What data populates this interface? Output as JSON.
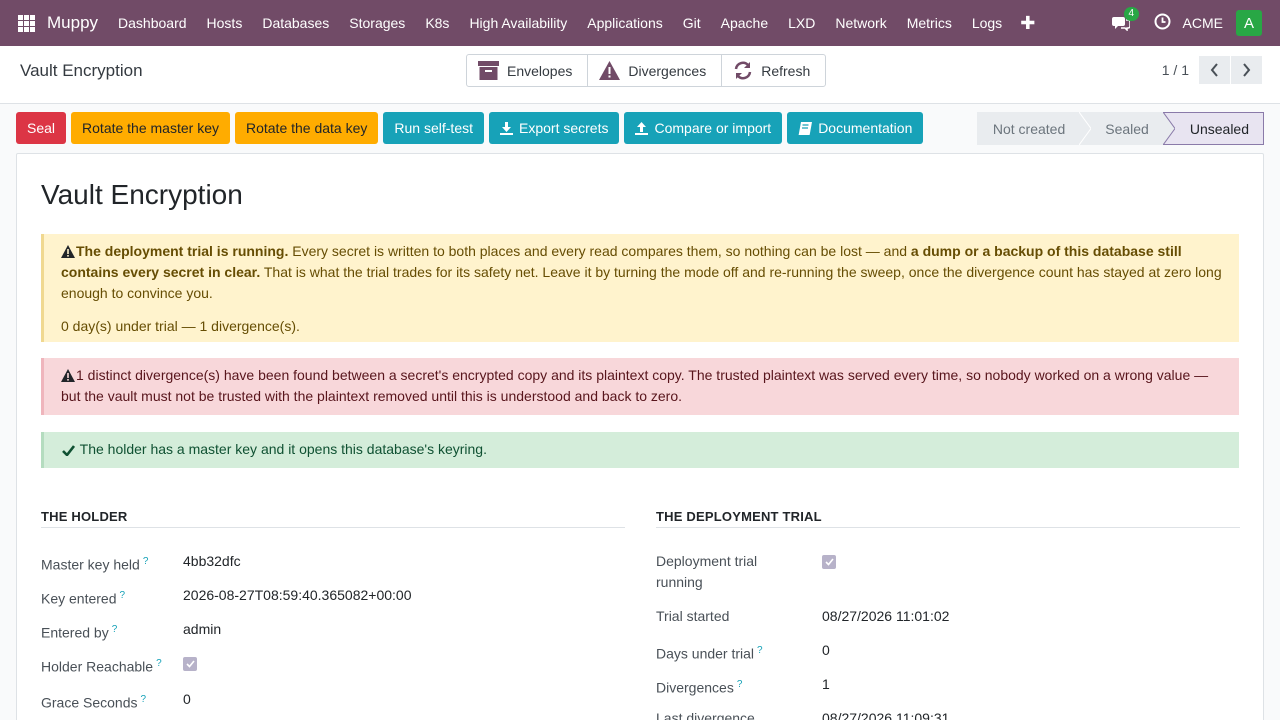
{
  "navbar": {
    "brand": "Muppy",
    "menu": [
      "Dashboard",
      "Hosts",
      "Databases",
      "Storages",
      "K8s",
      "High Availability",
      "Applications",
      "Git",
      "Apache",
      "LXD",
      "Network",
      "Metrics",
      "Logs"
    ],
    "message_count": "4",
    "company": "ACME",
    "avatar_letter": "A",
    "color": "#714b67"
  },
  "control": {
    "breadcrumb": "Vault Encryption",
    "smart_buttons": [
      "Envelopes",
      "Divergences",
      "Refresh"
    ],
    "pager": "1 / 1"
  },
  "actions": {
    "seal": "Seal",
    "rotate_master": "Rotate the master key",
    "rotate_data": "Rotate the data key",
    "self_test": "Run self-test",
    "export": "Export secrets",
    "compare": "Compare or import",
    "docs": "Documentation"
  },
  "status": {
    "stages": [
      "Not created",
      "Sealed",
      "Unsealed"
    ],
    "current": "Unsealed"
  },
  "sheet": {
    "title": "Vault Encryption",
    "trial_alert": {
      "bold1": "The deployment trial is running.",
      "text1": " Every secret is written to both places and every read compares them, so nothing can be lost — and ",
      "bold2": "a dump or a backup of this database still contains every secret in clear.",
      "text2": " That is what the trial trades for its safety net. Leave it by turning the mode off and re-running the sweep, once the divergence count has stayed at zero long enough to convince you.",
      "summary": "0 day(s) under trial — 1 divergence(s)."
    },
    "divergence_alert": "1 distinct divergence(s) have been found between a secret's encrypted copy and its plaintext copy. The trusted plaintext was served every time, so nobody worked on a wrong value — but the vault must not be trusted with the plaintext removed until this is understood and back to zero.",
    "holder_alert": "The holder has a master key and it opens this database's keyring.",
    "holder": {
      "title": "The Holder",
      "master_key_label": "Master key held",
      "master_key": "4bb32dfc",
      "key_entered_label": "Key entered",
      "key_entered": "2026-08-27T08:59:40.365082+00:00",
      "entered_by_label": "Entered by",
      "entered_by": "admin",
      "reachable_label": "Holder Reachable",
      "reachable": true,
      "grace_label": "Grace Seconds",
      "grace": "0"
    },
    "trial": {
      "title": "The Deployment Trial",
      "running_label_1": "Deployment trial",
      "running_label_2": "running",
      "running": true,
      "started_label": "Trial started",
      "started": "08/27/2026 11:01:02",
      "days_label": "Days under trial",
      "days": "0",
      "divergences_label": "Divergences",
      "divergences": "1",
      "last_label": "Last divergence",
      "last": "08/27/2026 11:09:31"
    }
  }
}
